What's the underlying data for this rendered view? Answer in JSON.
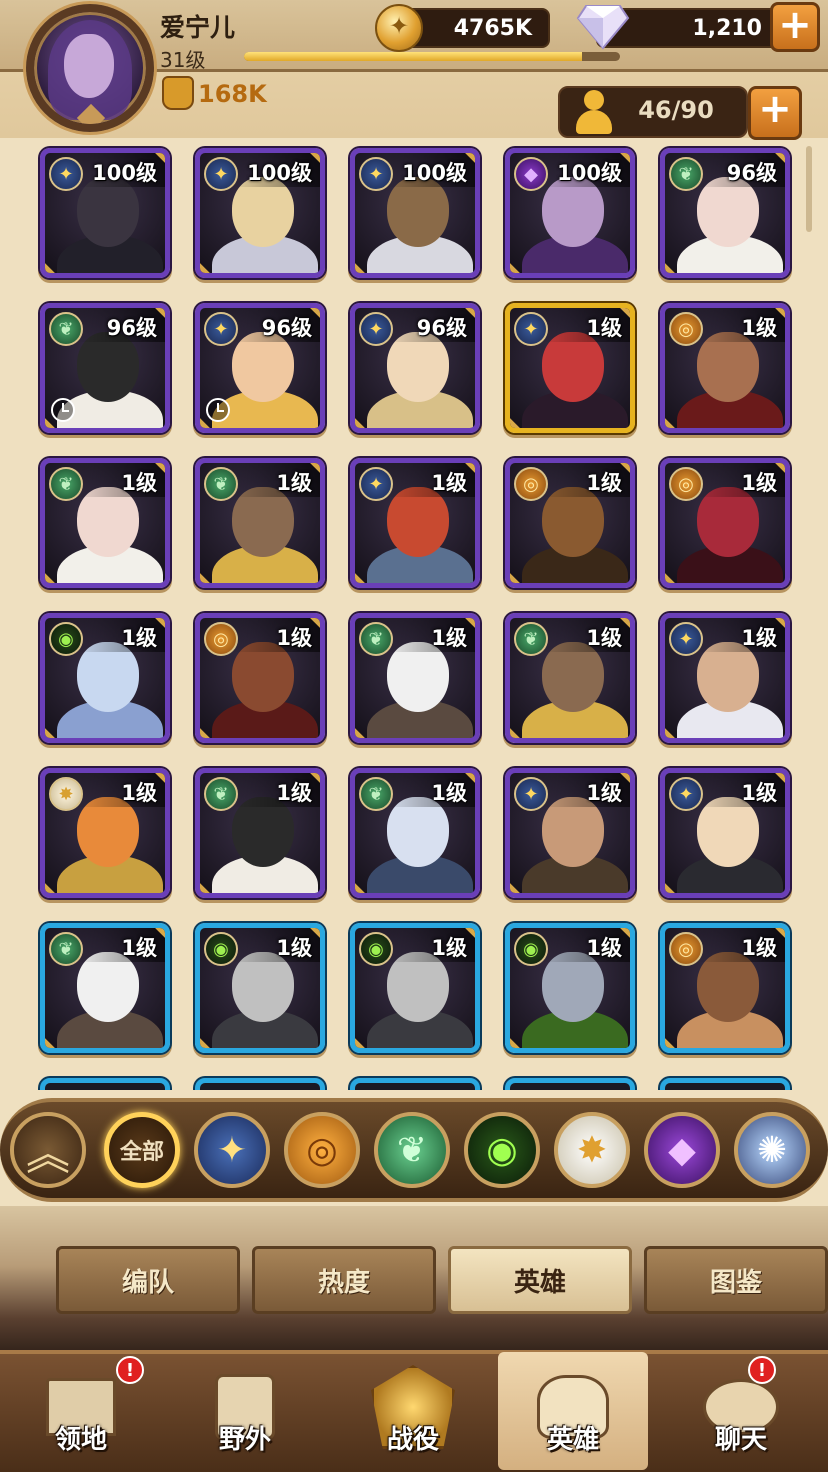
{
  "player": {
    "name": "爱宁儿",
    "level": "31级",
    "xp_progress": 0.9,
    "power": "168K"
  },
  "resources": {
    "gold": "4765K",
    "gold_icon": "gold-coin-icon",
    "diamonds": "1,210",
    "diamond_icon": "diamond-icon"
  },
  "roster": {
    "count": "46/90",
    "icon": "person-icon"
  },
  "heroes": [
    {
      "level": "100级",
      "faction": "lightbearer",
      "frame": "purple",
      "colors": [
        "#3a3440",
        "#22202a"
      ],
      "timer": false
    },
    {
      "level": "100级",
      "faction": "lightbearer",
      "frame": "purple",
      "colors": [
        "#e8d2a0",
        "#c8c8d8"
      ],
      "timer": false
    },
    {
      "level": "100级",
      "faction": "lightbearer",
      "frame": "purple",
      "colors": [
        "#8a6a48",
        "#d8d8e0"
      ],
      "timer": false
    },
    {
      "level": "100级",
      "faction": "hypogean",
      "frame": "purple",
      "colors": [
        "#b89ac8",
        "#4a2a6a"
      ],
      "timer": false
    },
    {
      "level": "96级",
      "faction": "wilder",
      "frame": "purple",
      "colors": [
        "#f0d8d0",
        "#f2f0ea"
      ],
      "timer": false
    },
    {
      "level": "96级",
      "faction": "wilder",
      "frame": "purple",
      "colors": [
        "#2a2a2a",
        "#f0ece4"
      ],
      "timer": true
    },
    {
      "level": "96级",
      "faction": "lightbearer",
      "frame": "purple",
      "colors": [
        "#f0c8a0",
        "#e8b850"
      ],
      "timer": true
    },
    {
      "level": "96级",
      "faction": "lightbearer",
      "frame": "purple",
      "colors": [
        "#f0d8b8",
        "#d8c088"
      ],
      "timer": false
    },
    {
      "level": "1级",
      "faction": "lightbearer",
      "frame": "gold",
      "colors": [
        "#c83a3a",
        "#2a1a2a"
      ],
      "timer": false
    },
    {
      "level": "1级",
      "faction": "mauler",
      "frame": "purple",
      "colors": [
        "#a87050",
        "#6a1a1a"
      ],
      "timer": false
    },
    {
      "level": "1级",
      "faction": "wilder",
      "frame": "purple",
      "colors": [
        "#f0d8d0",
        "#f2f0ea"
      ],
      "timer": false
    },
    {
      "level": "1级",
      "faction": "wilder",
      "frame": "purple",
      "colors": [
        "#8a6a50",
        "#d8b048"
      ],
      "timer": false
    },
    {
      "level": "1级",
      "faction": "lightbearer",
      "frame": "purple",
      "colors": [
        "#c84a30",
        "#5a7090"
      ],
      "timer": false
    },
    {
      "level": "1级",
      "faction": "mauler",
      "frame": "purple",
      "colors": [
        "#8a5a30",
        "#3a2818"
      ],
      "timer": false
    },
    {
      "level": "1级",
      "faction": "mauler",
      "frame": "purple",
      "colors": [
        "#a82a3a",
        "#3a1018"
      ],
      "timer": false
    },
    {
      "level": "1级",
      "faction": "graveborn",
      "frame": "purple",
      "colors": [
        "#c8d8f0",
        "#8aa0d0"
      ],
      "timer": false
    },
    {
      "level": "1级",
      "faction": "mauler",
      "frame": "purple",
      "colors": [
        "#8a4a30",
        "#5a1a18"
      ],
      "timer": false
    },
    {
      "level": "1级",
      "faction": "wilder",
      "frame": "purple",
      "colors": [
        "#f0f0f0",
        "#5a4a40"
      ],
      "timer": false
    },
    {
      "level": "1级",
      "faction": "wilder",
      "frame": "purple",
      "colors": [
        "#8a6a50",
        "#d8b048"
      ],
      "timer": false
    },
    {
      "level": "1级",
      "faction": "lightbearer",
      "frame": "purple",
      "colors": [
        "#d8b090",
        "#e8e8f0"
      ],
      "timer": false
    },
    {
      "level": "1级",
      "faction": "celestial",
      "frame": "purple",
      "colors": [
        "#e88a3a",
        "#c8a040"
      ],
      "timer": false
    },
    {
      "level": "1级",
      "faction": "wilder",
      "frame": "purple",
      "colors": [
        "#2a2a2a",
        "#f0ece4"
      ],
      "timer": false
    },
    {
      "level": "1级",
      "faction": "wilder",
      "frame": "purple",
      "colors": [
        "#d8e0f0",
        "#3a4a6a"
      ],
      "timer": false
    },
    {
      "level": "1级",
      "faction": "lightbearer",
      "frame": "purple",
      "colors": [
        "#c89a78",
        "#4a3a2a"
      ],
      "timer": false
    },
    {
      "level": "1级",
      "faction": "lightbearer",
      "frame": "purple",
      "colors": [
        "#f0d8b8",
        "#2a2a30"
      ],
      "timer": false
    },
    {
      "level": "1级",
      "faction": "wilder",
      "frame": "blue",
      "colors": [
        "#f0f0f0",
        "#5a4a40"
      ],
      "timer": false
    },
    {
      "level": "1级",
      "faction": "graveborn",
      "frame": "blue",
      "colors": [
        "#c0c0c0",
        "#3a3a40"
      ],
      "timer": false
    },
    {
      "level": "1级",
      "faction": "graveborn",
      "frame": "blue",
      "colors": [
        "#c0c0c0",
        "#3a3a40"
      ],
      "timer": false
    },
    {
      "level": "1级",
      "faction": "graveborn",
      "frame": "blue",
      "colors": [
        "#a0a8b8",
        "#3a6a20"
      ],
      "timer": false
    },
    {
      "level": "1级",
      "faction": "mauler",
      "frame": "blue",
      "colors": [
        "#8a5a3a",
        "#c89060"
      ],
      "timer": false
    }
  ],
  "faction_filters": {
    "all_label": "全部",
    "icons": [
      "up-chevron-icon",
      "lightbearer-icon",
      "mauler-icon",
      "wilder-icon",
      "graveborn-icon",
      "celestial-icon",
      "hypogean-icon",
      "dimensional-icon"
    ]
  },
  "tabs": [
    {
      "label": "编队",
      "active": false
    },
    {
      "label": "热度",
      "active": false
    },
    {
      "label": "英雄",
      "active": true
    },
    {
      "label": "图鉴",
      "active": false
    }
  ],
  "bottom_nav": [
    {
      "label": "领地",
      "icon": "castle-icon",
      "badge": "!"
    },
    {
      "label": "野外",
      "icon": "map-scroll-icon",
      "badge": ""
    },
    {
      "label": "战役",
      "icon": "crossed-swords-icon",
      "badge": ""
    },
    {
      "label": "英雄",
      "icon": "helmet-icon",
      "badge": "",
      "active": true
    },
    {
      "label": "聊天",
      "icon": "chat-bubble-icon",
      "badge": "!"
    }
  ]
}
